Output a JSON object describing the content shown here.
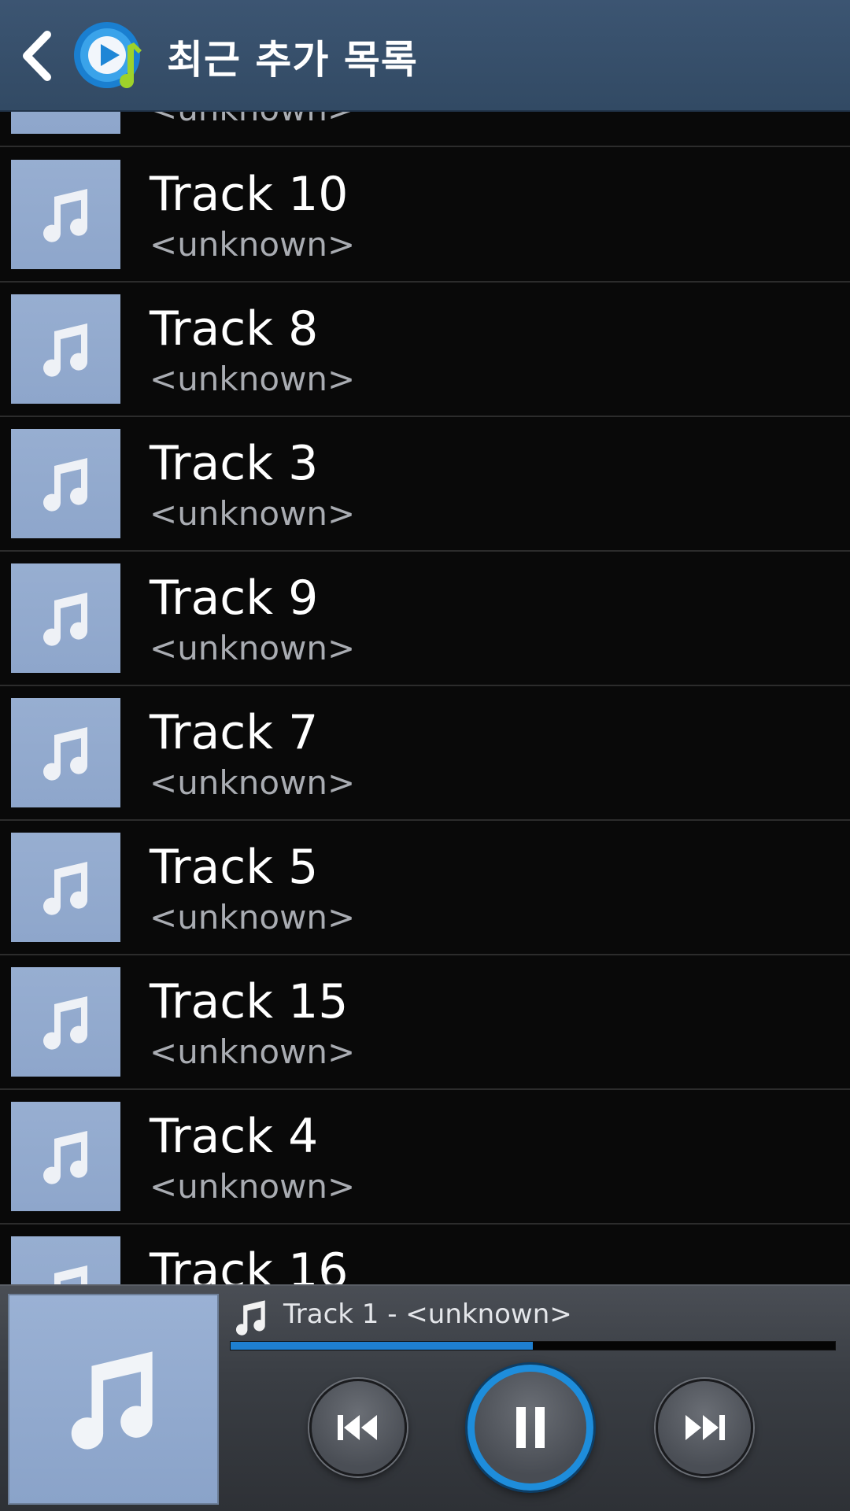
{
  "header": {
    "title": "최근 추가 목록",
    "back_icon": "chevron-left-icon",
    "app_icon": "music-player-app-icon"
  },
  "track_list": {
    "partial_top_artist": "<unknown>",
    "items": [
      {
        "title": "Track 10",
        "artist": "<unknown>"
      },
      {
        "title": "Track 8",
        "artist": "<unknown>"
      },
      {
        "title": "Track 3",
        "artist": "<unknown>"
      },
      {
        "title": "Track 9",
        "artist": "<unknown>"
      },
      {
        "title": "Track 7",
        "artist": "<unknown>"
      },
      {
        "title": "Track 5",
        "artist": "<unknown>"
      },
      {
        "title": "Track 15",
        "artist": "<unknown>"
      },
      {
        "title": "Track 4",
        "artist": "<unknown>"
      },
      {
        "title": "Track 16",
        "artist": ""
      }
    ]
  },
  "mini_player": {
    "now_playing": "Track 1 - <unknown>",
    "progress_fraction": 0.5,
    "state": "playing",
    "controls": [
      "previous-icon",
      "pause-icon",
      "next-icon"
    ]
  },
  "colors": {
    "action_bar": "#344c67",
    "background": "#090909",
    "accent": "#1e8ddb",
    "thumbnail": "#8fa7cb"
  }
}
